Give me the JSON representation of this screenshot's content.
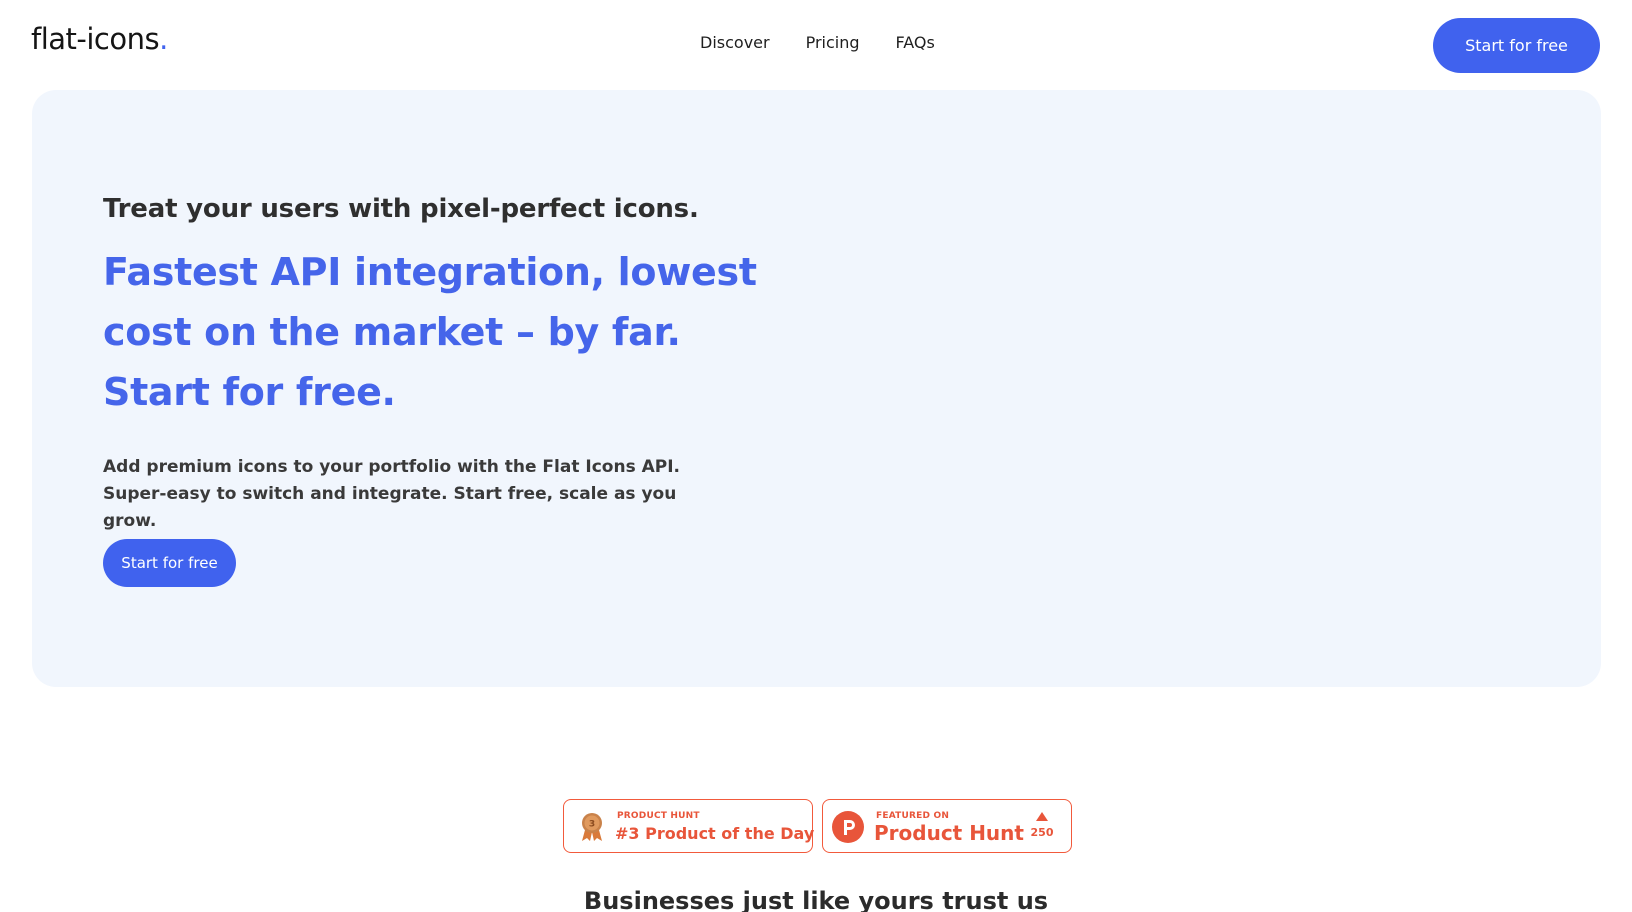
{
  "brand": {
    "name": "flat-icons",
    "dot": ".",
    "accent_color": "#4062ee"
  },
  "nav": {
    "items": [
      {
        "label": "Discover"
      },
      {
        "label": "Pricing"
      },
      {
        "label": "FAQs"
      }
    ]
  },
  "header": {
    "cta_label": "Start for free"
  },
  "hero": {
    "kicker": "Treat your users with pixel-perfect icons.",
    "title_lines": [
      "Fastest API integration, lowest",
      "cost on the market – by far.",
      "Start for free."
    ],
    "description": "Add premium icons to your portfolio with the Flat Icons API. Super-easy to switch and integrate. Start free, scale as you grow.",
    "cta_label": "Start for free",
    "background_color": "#f1f6fd"
  },
  "badges": {
    "product_of_day": {
      "small": "PRODUCT HUNT",
      "big": "#3 Product of the Day",
      "medal_rank": "3",
      "icon": "medal-icon"
    },
    "featured": {
      "small": "FEATURED ON",
      "big": "Product Hunt",
      "upvotes": "250",
      "icon": "product-hunt-icon",
      "color": "#e8553a"
    }
  },
  "trust": {
    "heading": "Businesses just like yours trust us"
  }
}
